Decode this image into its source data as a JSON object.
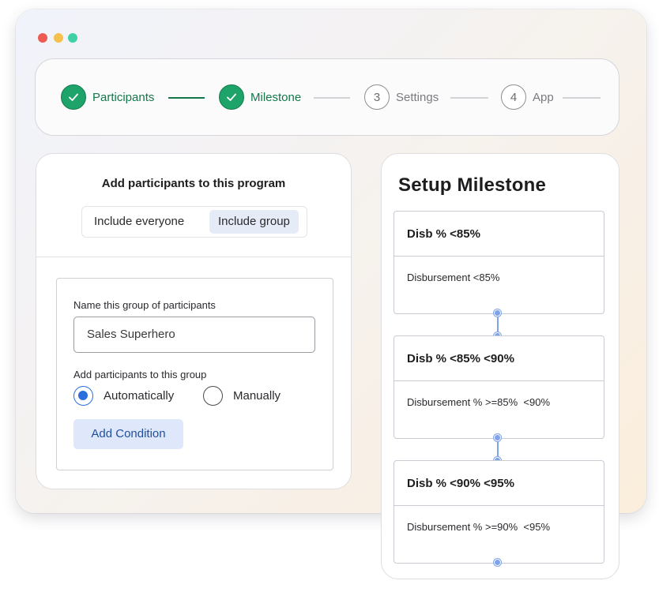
{
  "stepper": {
    "steps": [
      {
        "label": "Participants",
        "marker": "",
        "state": "done"
      },
      {
        "label": "Milestone",
        "marker": "",
        "state": "done"
      },
      {
        "label": "Settings",
        "marker": "3",
        "state": "pending"
      },
      {
        "label": "App",
        "marker": "4",
        "state": "pending"
      }
    ]
  },
  "participants": {
    "title": "Add participants to this program",
    "segment": {
      "option_a": "Include everyone",
      "option_b": "Include group",
      "selected": "Include group"
    },
    "group_name_label": "Name this group of participants",
    "group_name_value": "Sales Superhero",
    "add_label": "Add participants to this group",
    "radio_auto": "Automatically",
    "radio_manual": "Manually",
    "radio_selected": "Automatically",
    "add_condition": "Add Condition"
  },
  "milestone": {
    "title": "Setup Milestone",
    "items": [
      {
        "heading": "Disb % <85%",
        "description": "Disbursement <85%"
      },
      {
        "heading": "Disb % <85% <90%",
        "description": "Disbursement % >=85%  <90%"
      },
      {
        "heading": "Disb % <90% <95%",
        "description": "Disbursement % >=90%  <95%"
      }
    ]
  },
  "colors": {
    "accent_green": "#1ea46a",
    "accent_blue": "#2c6fdc",
    "connector_blue": "#7fa3e6"
  }
}
